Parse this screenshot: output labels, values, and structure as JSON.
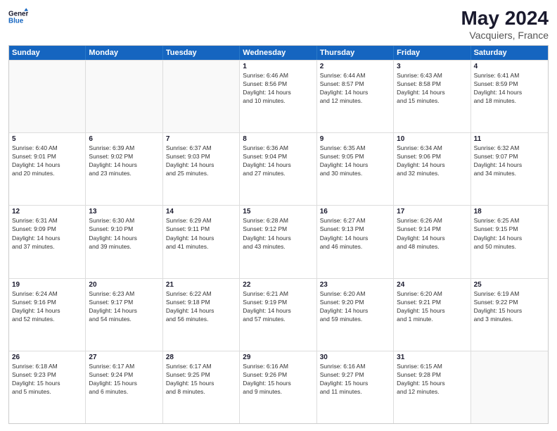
{
  "header": {
    "logo_general": "General",
    "logo_blue": "Blue",
    "month_year": "May 2024",
    "location": "Vacquiers, France"
  },
  "days_of_week": [
    "Sunday",
    "Monday",
    "Tuesday",
    "Wednesday",
    "Thursday",
    "Friday",
    "Saturday"
  ],
  "rows": [
    [
      {
        "day": "",
        "lines": []
      },
      {
        "day": "",
        "lines": []
      },
      {
        "day": "",
        "lines": []
      },
      {
        "day": "1",
        "lines": [
          "Sunrise: 6:46 AM",
          "Sunset: 8:56 PM",
          "Daylight: 14 hours",
          "and 10 minutes."
        ]
      },
      {
        "day": "2",
        "lines": [
          "Sunrise: 6:44 AM",
          "Sunset: 8:57 PM",
          "Daylight: 14 hours",
          "and 12 minutes."
        ]
      },
      {
        "day": "3",
        "lines": [
          "Sunrise: 6:43 AM",
          "Sunset: 8:58 PM",
          "Daylight: 14 hours",
          "and 15 minutes."
        ]
      },
      {
        "day": "4",
        "lines": [
          "Sunrise: 6:41 AM",
          "Sunset: 8:59 PM",
          "Daylight: 14 hours",
          "and 18 minutes."
        ]
      }
    ],
    [
      {
        "day": "5",
        "lines": [
          "Sunrise: 6:40 AM",
          "Sunset: 9:01 PM",
          "Daylight: 14 hours",
          "and 20 minutes."
        ]
      },
      {
        "day": "6",
        "lines": [
          "Sunrise: 6:39 AM",
          "Sunset: 9:02 PM",
          "Daylight: 14 hours",
          "and 23 minutes."
        ]
      },
      {
        "day": "7",
        "lines": [
          "Sunrise: 6:37 AM",
          "Sunset: 9:03 PM",
          "Daylight: 14 hours",
          "and 25 minutes."
        ]
      },
      {
        "day": "8",
        "lines": [
          "Sunrise: 6:36 AM",
          "Sunset: 9:04 PM",
          "Daylight: 14 hours",
          "and 27 minutes."
        ]
      },
      {
        "day": "9",
        "lines": [
          "Sunrise: 6:35 AM",
          "Sunset: 9:05 PM",
          "Daylight: 14 hours",
          "and 30 minutes."
        ]
      },
      {
        "day": "10",
        "lines": [
          "Sunrise: 6:34 AM",
          "Sunset: 9:06 PM",
          "Daylight: 14 hours",
          "and 32 minutes."
        ]
      },
      {
        "day": "11",
        "lines": [
          "Sunrise: 6:32 AM",
          "Sunset: 9:07 PM",
          "Daylight: 14 hours",
          "and 34 minutes."
        ]
      }
    ],
    [
      {
        "day": "12",
        "lines": [
          "Sunrise: 6:31 AM",
          "Sunset: 9:09 PM",
          "Daylight: 14 hours",
          "and 37 minutes."
        ]
      },
      {
        "day": "13",
        "lines": [
          "Sunrise: 6:30 AM",
          "Sunset: 9:10 PM",
          "Daylight: 14 hours",
          "and 39 minutes."
        ]
      },
      {
        "day": "14",
        "lines": [
          "Sunrise: 6:29 AM",
          "Sunset: 9:11 PM",
          "Daylight: 14 hours",
          "and 41 minutes."
        ]
      },
      {
        "day": "15",
        "lines": [
          "Sunrise: 6:28 AM",
          "Sunset: 9:12 PM",
          "Daylight: 14 hours",
          "and 43 minutes."
        ]
      },
      {
        "day": "16",
        "lines": [
          "Sunrise: 6:27 AM",
          "Sunset: 9:13 PM",
          "Daylight: 14 hours",
          "and 46 minutes."
        ]
      },
      {
        "day": "17",
        "lines": [
          "Sunrise: 6:26 AM",
          "Sunset: 9:14 PM",
          "Daylight: 14 hours",
          "and 48 minutes."
        ]
      },
      {
        "day": "18",
        "lines": [
          "Sunrise: 6:25 AM",
          "Sunset: 9:15 PM",
          "Daylight: 14 hours",
          "and 50 minutes."
        ]
      }
    ],
    [
      {
        "day": "19",
        "lines": [
          "Sunrise: 6:24 AM",
          "Sunset: 9:16 PM",
          "Daylight: 14 hours",
          "and 52 minutes."
        ]
      },
      {
        "day": "20",
        "lines": [
          "Sunrise: 6:23 AM",
          "Sunset: 9:17 PM",
          "Daylight: 14 hours",
          "and 54 minutes."
        ]
      },
      {
        "day": "21",
        "lines": [
          "Sunrise: 6:22 AM",
          "Sunset: 9:18 PM",
          "Daylight: 14 hours",
          "and 56 minutes."
        ]
      },
      {
        "day": "22",
        "lines": [
          "Sunrise: 6:21 AM",
          "Sunset: 9:19 PM",
          "Daylight: 14 hours",
          "and 57 minutes."
        ]
      },
      {
        "day": "23",
        "lines": [
          "Sunrise: 6:20 AM",
          "Sunset: 9:20 PM",
          "Daylight: 14 hours",
          "and 59 minutes."
        ]
      },
      {
        "day": "24",
        "lines": [
          "Sunrise: 6:20 AM",
          "Sunset: 9:21 PM",
          "Daylight: 15 hours",
          "and 1 minute."
        ]
      },
      {
        "day": "25",
        "lines": [
          "Sunrise: 6:19 AM",
          "Sunset: 9:22 PM",
          "Daylight: 15 hours",
          "and 3 minutes."
        ]
      }
    ],
    [
      {
        "day": "26",
        "lines": [
          "Sunrise: 6:18 AM",
          "Sunset: 9:23 PM",
          "Daylight: 15 hours",
          "and 5 minutes."
        ]
      },
      {
        "day": "27",
        "lines": [
          "Sunrise: 6:17 AM",
          "Sunset: 9:24 PM",
          "Daylight: 15 hours",
          "and 6 minutes."
        ]
      },
      {
        "day": "28",
        "lines": [
          "Sunrise: 6:17 AM",
          "Sunset: 9:25 PM",
          "Daylight: 15 hours",
          "and 8 minutes."
        ]
      },
      {
        "day": "29",
        "lines": [
          "Sunrise: 6:16 AM",
          "Sunset: 9:26 PM",
          "Daylight: 15 hours",
          "and 9 minutes."
        ]
      },
      {
        "day": "30",
        "lines": [
          "Sunrise: 6:16 AM",
          "Sunset: 9:27 PM",
          "Daylight: 15 hours",
          "and 11 minutes."
        ]
      },
      {
        "day": "31",
        "lines": [
          "Sunrise: 6:15 AM",
          "Sunset: 9:28 PM",
          "Daylight: 15 hours",
          "and 12 minutes."
        ]
      },
      {
        "day": "",
        "lines": []
      }
    ]
  ]
}
